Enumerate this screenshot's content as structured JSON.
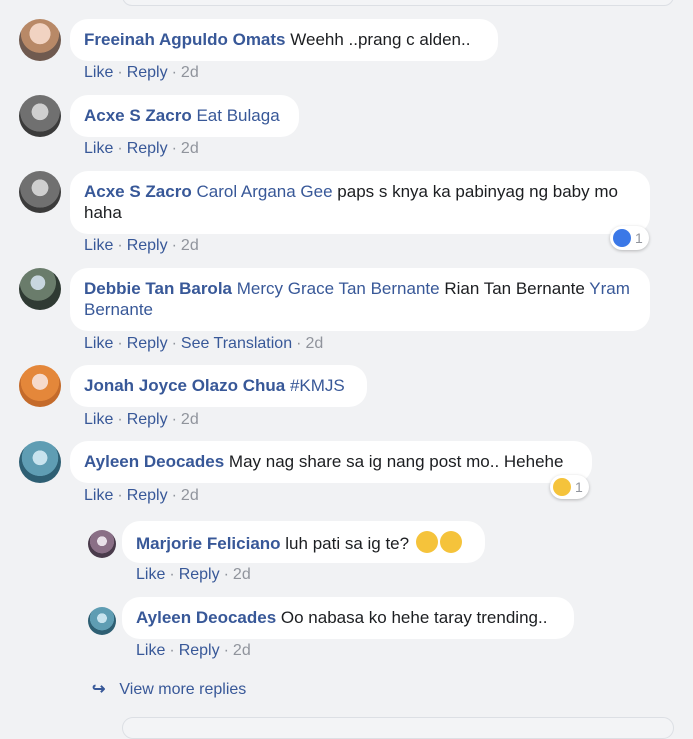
{
  "comments": [
    {
      "author": "Freeinah Agpuldo Omats",
      "text": "Weehh ..prang c alden..",
      "like": "Like",
      "reply": "Reply",
      "time": "2d"
    },
    {
      "author": "Acxe S Zacro",
      "tag": "Eat Bulaga",
      "text": "",
      "like": "Like",
      "reply": "Reply",
      "time": "2d"
    },
    {
      "author": "Acxe S Zacro",
      "tag": "Carol Argana Gee",
      "text": "paps s knya ka pabinyag ng baby mo haha",
      "like": "Like",
      "reply": "Reply",
      "time": "2d",
      "reaction": {
        "icon": "like-icon",
        "count": "1"
      }
    },
    {
      "author": "Debbie Tan Barola",
      "tags": [
        "Mercy Grace Tan Bernante",
        "Rian Tan Bernante",
        "Yram Bernante"
      ],
      "like": "Like",
      "reply": "Reply",
      "translate": "See Translation",
      "time": "2d"
    },
    {
      "author": "Jonah Joyce Olazo Chua",
      "tag": "#KMJS",
      "like": "Like",
      "reply": "Reply",
      "time": "2d"
    },
    {
      "author": "Ayleen Deocades",
      "text": "May nag share sa ig nang post mo.. Hehehe",
      "like": "Like",
      "reply": "Reply",
      "time": "2d",
      "reaction": {
        "icon": "haha-icon",
        "count": "1"
      }
    }
  ],
  "replies": [
    {
      "author": "Marjorie Feliciano",
      "text": "luh pati sa ig te?",
      "emojis": [
        "laughing-emoji",
        "laughing-emoji"
      ],
      "like": "Like",
      "reply": "Reply",
      "time": "2d"
    },
    {
      "author": "Ayleen Deocades",
      "text": "Oo nabasa ko hehe taray trending..",
      "like": "Like",
      "reply": "Reply",
      "time": "2d"
    }
  ],
  "view_more": "View more replies",
  "colors": {
    "link": "#385898",
    "meta": "#90949c",
    "bubble": "#ffffff",
    "background": "#f1f2f4"
  }
}
